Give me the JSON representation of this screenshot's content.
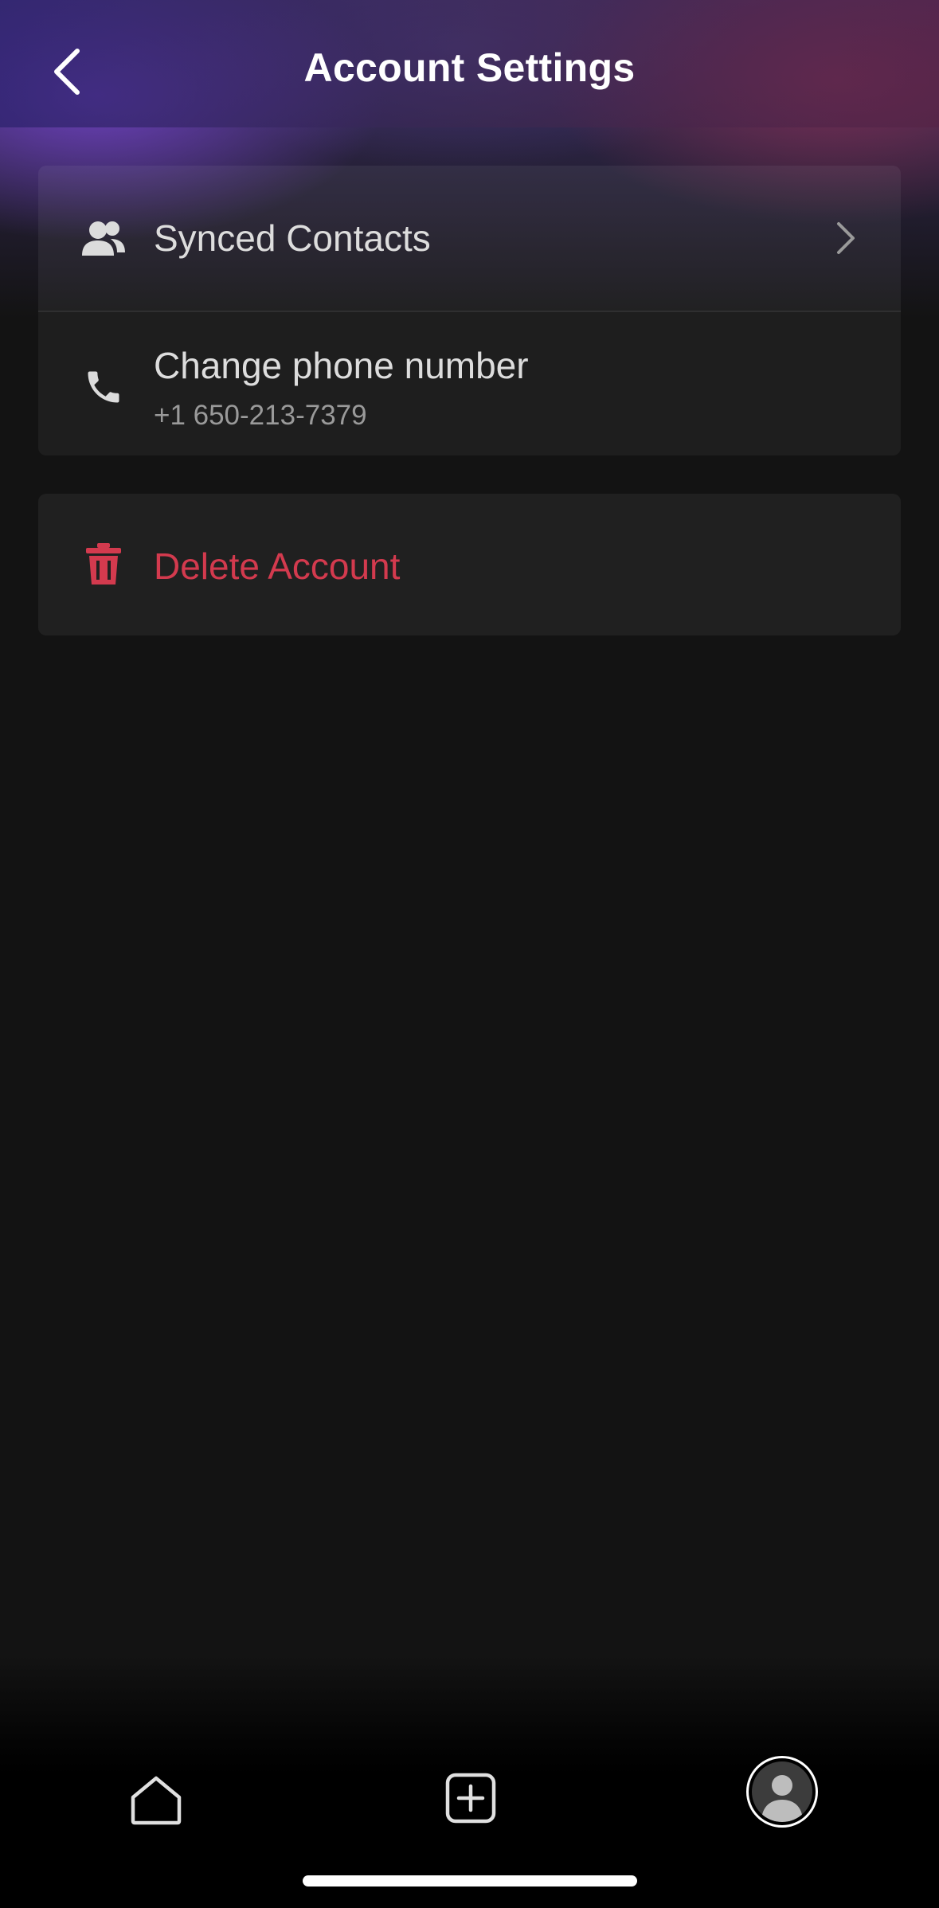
{
  "header": {
    "title": "Account Settings",
    "back_icon": "chevron-left-icon"
  },
  "settings": {
    "synced_contacts": {
      "label": "Synced Contacts",
      "icon": "people-icon",
      "trailing_icon": "chevron-right-icon"
    },
    "change_phone": {
      "label": "Change phone number",
      "value": "+1 650-213-7379",
      "icon": "phone-icon"
    }
  },
  "danger": {
    "delete_account": {
      "label": "Delete Account",
      "icon": "trash-icon",
      "color": "#d33a4e"
    }
  },
  "bottom_nav": {
    "items": [
      {
        "name": "home",
        "icon": "home-icon"
      },
      {
        "name": "create",
        "icon": "plus-square-icon"
      },
      {
        "name": "profile",
        "icon": "avatar-icon",
        "active": true
      }
    ]
  },
  "colors": {
    "background": "#131313",
    "card": "#202020",
    "accent_danger": "#d33a4e",
    "text_primary": "#dddddd",
    "text_secondary": "#9a9a9a"
  }
}
